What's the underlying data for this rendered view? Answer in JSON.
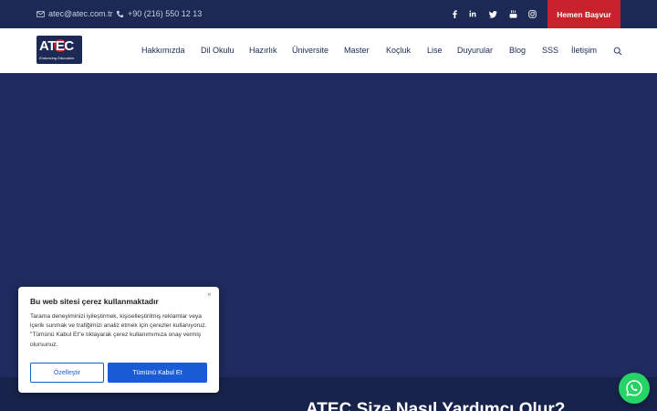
{
  "topbar": {
    "email": "atec@atec.com.tr",
    "phone": "+90 (216) 550 12 13",
    "social": [
      "facebook",
      "linkedin",
      "twitter",
      "youtube",
      "instagram"
    ],
    "cta_label": "Hemen Başvur"
  },
  "logo": {
    "text": "ATEC",
    "tagline": "Embracing Education"
  },
  "nav": {
    "items": [
      "Hakkımızda",
      "Dil Okulu",
      "Hazırlık",
      "Üniversite",
      "Master",
      "Koçluk",
      "Lise",
      "Duyurular",
      "Blog",
      "SSS",
      "İletişim"
    ]
  },
  "band": {
    "heading": "ATEC Size Nasıl Yardımcı Olur?"
  },
  "cookie": {
    "title": "Bu web sitesi çerez kullanmaktadır",
    "text": "Tarama deneyiminizi iyileştirmek, kişiselleştirilmiş reklamlar veya içerik sunmak ve trafiğimizi analiz etmek için çerezler kullanıyoruz. \"Tümünü Kabul Et\"e tıklayarak çerez kullanımımıza onay vermiş olursunuz.",
    "customize_label": "Özelleştir",
    "accept_label": "Tümünü Kabul Et",
    "close_label": "×"
  },
  "colors": {
    "navy": "#1b2954",
    "hero": "#1f2b5e",
    "cta_red": "#c8232c",
    "button_blue": "#1a5cd6",
    "whatsapp_green": "#25d366"
  }
}
